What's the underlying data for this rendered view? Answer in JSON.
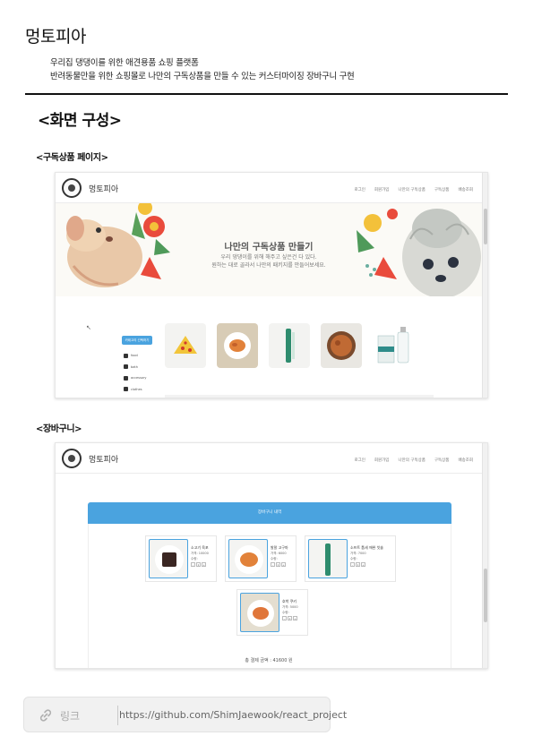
{
  "header": {
    "title": "멍토피아",
    "description_line1": "우리집 댕댕이를 위한 애견용품 쇼핑 플랫폼",
    "description_line2": "반려동물만을 위한 쇼핑몰로 나만의 구독상품을 만들 수 있는 커스터마이징 장바구니 구현"
  },
  "section": {
    "heading": "<화면 구성>",
    "subscription_heading": "<구독상품 페이지>",
    "cart_heading": "<장바구니>"
  },
  "screenshot_subscription": {
    "brand": "멍토피아",
    "menu": [
      "로그인",
      "회원가입",
      "나만의 구독상품",
      "구독상품",
      "배송조회"
    ],
    "banner_title": "나만의 구독상품 만들기",
    "banner_sub1": "우리 댕댕이를 위해 해주고 싶은건 다 있다.",
    "banner_sub2": "원하는 대로 골라서 나만의 패키지를 만들어보세요.",
    "category_button": "카테고리 선택하기",
    "categories": [
      "food",
      "bath",
      "accessory",
      "clothes",
      "toy"
    ]
  },
  "screenshot_cart": {
    "brand": "멍토피아",
    "menu": [
      "로그인",
      "회원가입",
      "나만의 구독상품",
      "구독상품",
      "배송조회"
    ],
    "cart_title": "장바구니 내역",
    "items": [
      {
        "name": "소고기 육포",
        "price": "가격: 10000",
        "qty": "수량:"
      },
      {
        "name": "발랄 고구마",
        "price": "가격: 6000",
        "qty": "수량:"
      },
      {
        "name": "소프트 톱세 애완 칫솔",
        "price": "가격: 7000",
        "qty": "수량:"
      },
      {
        "name": "호박 쿠키",
        "price": "가격: 5000",
        "qty": "수량:"
      }
    ],
    "qty_buttons": [
      "-",
      "1",
      "+"
    ],
    "total": "총 결제 금액 : 41600 원"
  },
  "link": {
    "label": "링크",
    "url": "https://github.com/ShimJaewook/react_project"
  },
  "colors": {
    "accent_blue": "#4aa3df",
    "text": "#111111",
    "link_box_bg": "#f1f1f1"
  },
  "icons": [
    "link-icon",
    "dog-logo-icon",
    "checkbox-icon",
    "cursor-icon"
  ]
}
